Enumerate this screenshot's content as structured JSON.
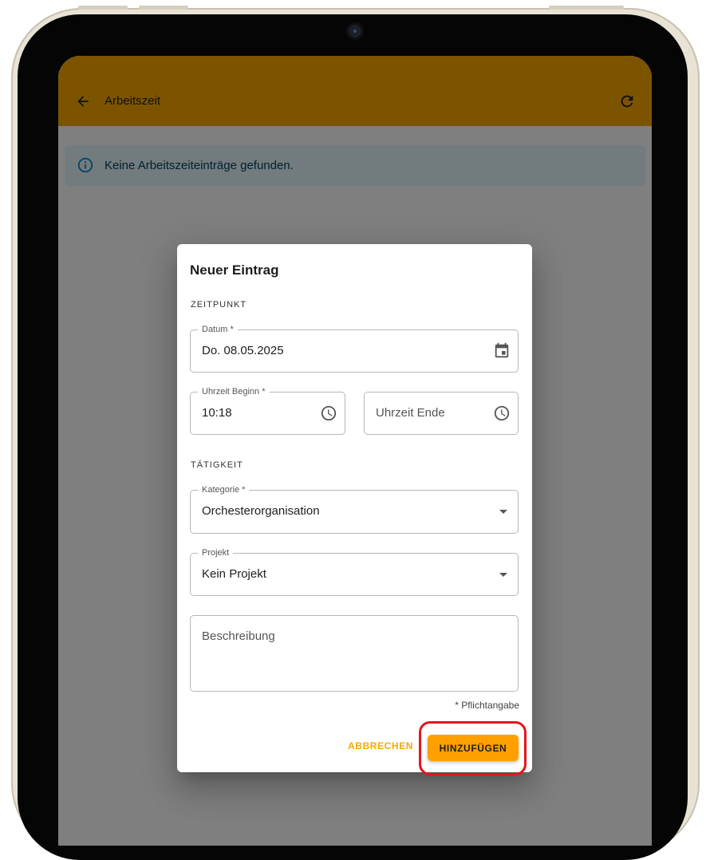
{
  "appbar": {
    "title": "Arbeitszeit",
    "back_icon": "arrow-left-icon",
    "refresh_icon": "refresh-icon",
    "color": "#f9a800"
  },
  "info_alert": {
    "text": "Keine Arbeitszeiteinträge gefunden.",
    "icon": "info-icon"
  },
  "dialog": {
    "title": "Neuer Eintrag",
    "section_time": "ZEITPUNKT",
    "date_field": {
      "label": "Datum *",
      "value": "Do. 08.05.2025",
      "icon": "calendar-icon"
    },
    "start_time_field": {
      "label": "Uhrzeit Beginn *",
      "value": "10:18",
      "icon": "clock-icon"
    },
    "end_time_field": {
      "placeholder": "Uhrzeit Ende",
      "icon": "clock-icon"
    },
    "section_activity": "TÄTIGKEIT",
    "category_field": {
      "label": "Kategorie *",
      "value": "Orchesterorganisation"
    },
    "project_field": {
      "label": "Projekt",
      "value": "Kein Projekt"
    },
    "description_field": {
      "placeholder": "Beschreibung"
    },
    "required_note": "* Pflichtangabe",
    "cancel_label": "ABBRECHEN",
    "add_label": "HINZUFÜGEN",
    "accent_color": "#ffa000"
  }
}
